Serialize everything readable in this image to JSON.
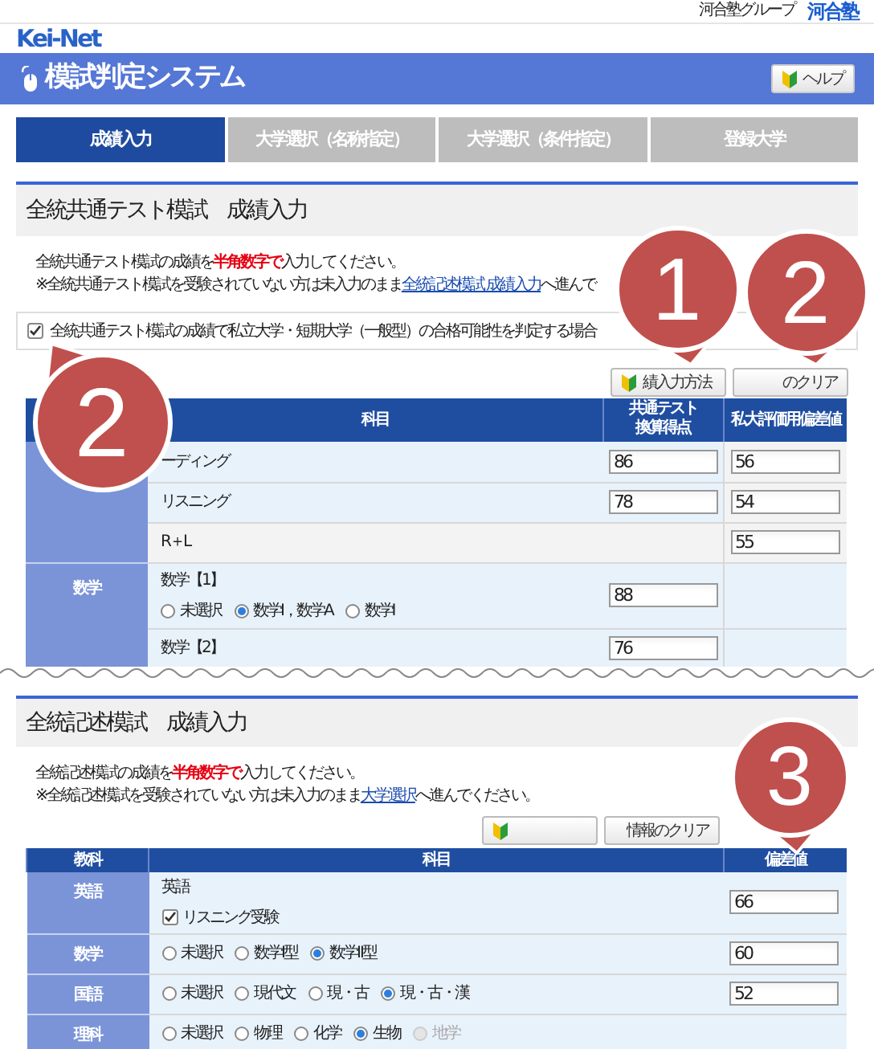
{
  "header": {
    "group_label": "河合塾グループ",
    "brand": "河合塾",
    "site_logo": "Kei-Net"
  },
  "title_bar": {
    "title": "模試判定システム",
    "help_button": "ヘルプ"
  },
  "tabs": [
    {
      "label": "成績入力",
      "selected": true
    },
    {
      "label": "大学選択（名称指定）",
      "selected": false
    },
    {
      "label": "大学選択（条件指定）",
      "selected": false
    },
    {
      "label": "登録大学",
      "selected": false
    }
  ],
  "section_1": {
    "title": "全統共通テスト模試　成績入力",
    "instruction": {
      "before": "全統共通テスト模試の成績を",
      "emphasis": "半角数字で",
      "after": "入力してください。"
    },
    "note": {
      "before": "※全統共通テスト模試を受験されていない方は未入力のまま",
      "link": "全統記述模試 成績入力",
      "after": "へ進んで"
    },
    "option": {
      "label": "全統共通テスト模試の成績で私立大学・短期大学（一般型）の合格可能性を判定する場合",
      "checked": true
    },
    "buttons": [
      {
        "kind": "guide",
        "label": "績入力方法"
      },
      {
        "kind": "plain",
        "label": "のクリア"
      }
    ],
    "table": {
      "columns": [
        "科目",
        "共通テスト換算得点",
        "私大評価用偏差値"
      ],
      "groups": [
        {
          "rows": [
            {
              "kind": "score",
              "name": "ーディング",
              "score": "86",
              "deviation": "56"
            },
            {
              "kind": "score",
              "name": "リスニング",
              "score": "78",
              "deviation": "54"
            },
            {
              "kind": "total",
              "name": "R＋L",
              "deviation": "55"
            }
          ]
        },
        {
          "subject": "数学",
          "rows": [
            {
              "kind": "score",
              "name": "数学【1】",
              "options": [
                {
                  "label": "未選択",
                  "selected": false,
                  "disabled": false
                },
                {
                  "label": "数学Ⅰ，数学A",
                  "selected": true,
                  "disabled": false
                },
                {
                  "label": "数学Ⅰ",
                  "selected": false,
                  "disabled": false
                }
              ],
              "score": "88"
            },
            {
              "kind": "score",
              "name": "数学【2】",
              "score": "76"
            }
          ]
        }
      ]
    }
  },
  "section_2": {
    "title": "全統記述模試　成績入力",
    "instruction": {
      "before": "全統記述模試の成績を",
      "emphasis": "半角数字で",
      "after": "入力してください。"
    },
    "note": {
      "before": "※全統記述模試を受験されていない方は未入力のまま",
      "link": "大学選択",
      "after": "へ進んでください。"
    },
    "buttons": [
      {
        "kind": "guide"
      },
      {
        "kind": "plain",
        "label": "情報のクリア"
      }
    ],
    "table": {
      "columns": [
        "教科",
        "科目",
        "偏差値"
      ],
      "rows": [
        {
          "subject": "英語",
          "name": "英語",
          "check": {
            "label": "リスニング受験",
            "checked": true
          },
          "deviation": "66"
        },
        {
          "subject": "数学",
          "options": [
            {
              "label": "未選択",
              "selected": false,
              "disabled": false
            },
            {
              "label": "数学Ⅰ型",
              "selected": false,
              "disabled": false
            },
            {
              "label": "数学Ⅱ型",
              "selected": true,
              "disabled": false
            }
          ],
          "deviation": "60"
        },
        {
          "subject": "国語",
          "options": [
            {
              "label": "未選択",
              "selected": false,
              "disabled": false
            },
            {
              "label": "現代文",
              "selected": false,
              "disabled": false
            },
            {
              "label": "現・古",
              "selected": false,
              "disabled": false
            },
            {
              "label": "現・古・漢",
              "selected": true,
              "disabled": false
            }
          ],
          "deviation": "52"
        },
        {
          "subject": "理科",
          "options": [
            {
              "label": "未選択",
              "selected": false,
              "disabled": false
            },
            {
              "label": "物理",
              "selected": false,
              "disabled": false
            },
            {
              "label": "化学",
              "selected": false,
              "disabled": false
            },
            {
              "label": "生物",
              "selected": true,
              "disabled": false
            },
            {
              "label": "地学",
              "selected": false,
              "disabled": true
            }
          ]
        }
      ]
    }
  },
  "callouts": [
    {
      "number": "1"
    },
    {
      "number": "2"
    },
    {
      "number": "2"
    },
    {
      "number": "3"
    }
  ]
}
